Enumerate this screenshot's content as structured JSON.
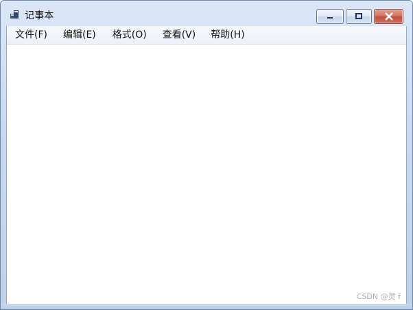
{
  "window": {
    "title": "记事本"
  },
  "menu": [
    {
      "label": "文件(F)"
    },
    {
      "label": "编辑(E)"
    },
    {
      "label": "格式(O)"
    },
    {
      "label": "查看(V)"
    },
    {
      "label": "帮助(H)"
    }
  ],
  "watermark": "CSDN @灵 f",
  "icons": {
    "app": "notepad-icon",
    "minimize": "minimize-icon",
    "maximize": "maximize-icon",
    "close": "close-icon"
  },
  "colors": {
    "close_button": "#c14f3c",
    "frame": "#c8d9ef"
  }
}
